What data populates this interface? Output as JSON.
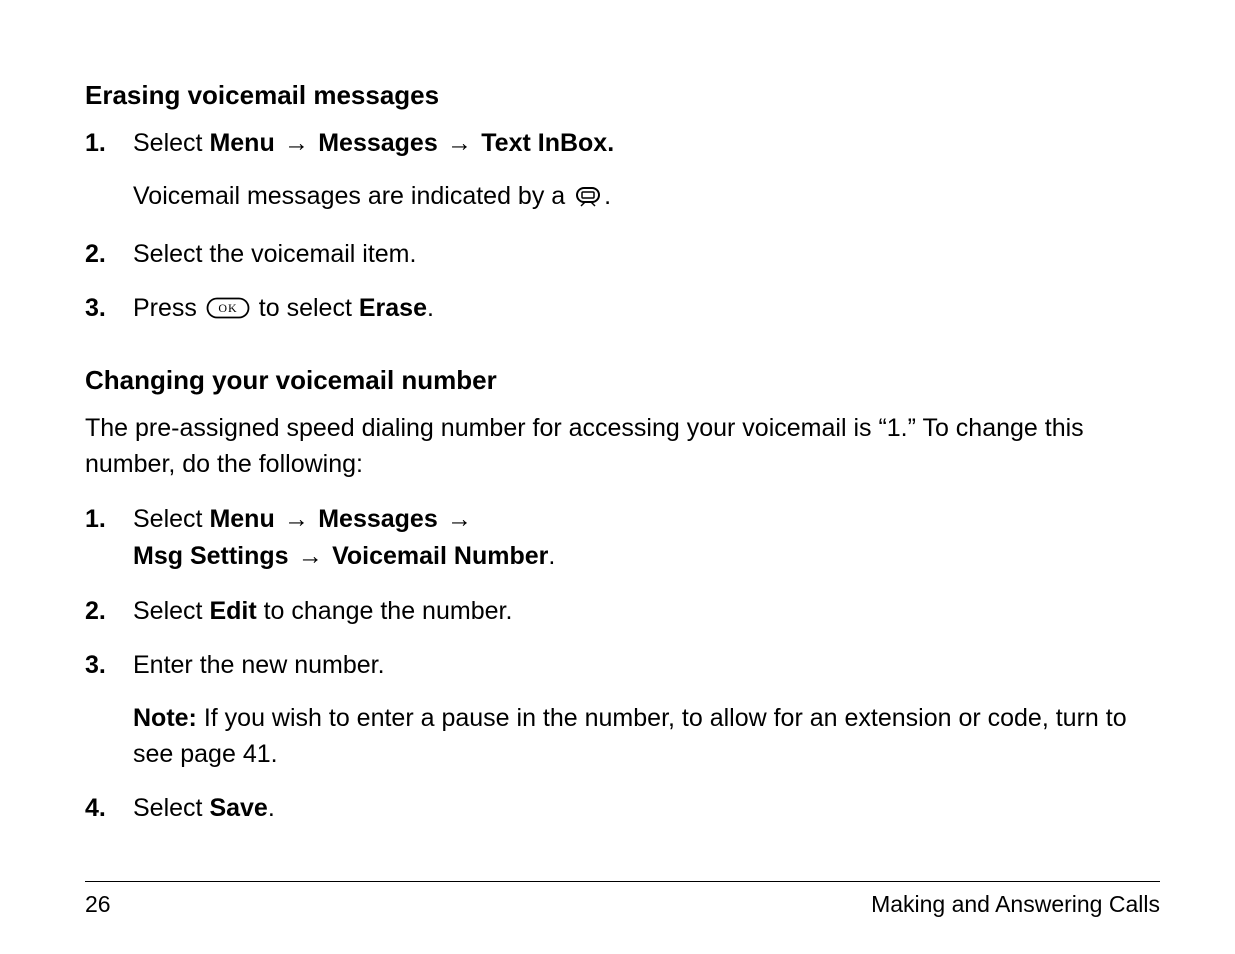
{
  "section1": {
    "heading": "Erasing voicemail messages",
    "items": [
      {
        "num": "1.",
        "pre": "Select ",
        "menu": "Menu",
        "arrow1": " → ",
        "messages": "Messages",
        "arrow2": " → ",
        "textinbox": "Text InBox.",
        "sub_pre": "Voicemail messages are indicated by a ",
        "sub_post": "."
      },
      {
        "num": "2.",
        "text": "Select the voicemail item."
      },
      {
        "num": "3.",
        "pre": "Press ",
        "mid": "  to select ",
        "erase": "Erase",
        "post": "."
      }
    ]
  },
  "section2": {
    "heading": "Changing your voicemail number",
    "intro": "The pre-assigned speed dialing number for accessing your voicemail is “1.” To change this number, do the following:",
    "items": [
      {
        "num": "1.",
        "pre": "Select ",
        "menu": "Menu",
        "arrow1": " → ",
        "messages": "Messages",
        "arrow2": " →",
        "msgsettings": "Msg Settings",
        "arrow3": " → ",
        "vmnumber": "Voicemail Number",
        "post": "."
      },
      {
        "num": "2.",
        "pre": "Select ",
        "edit": "Edit",
        "post": " to change the number."
      },
      {
        "num": "3.",
        "text": "Enter the new number.",
        "note_label": "Note:",
        "note_body": " If you wish to enter a pause in the number, to allow for an extension or code, turn to see page 41."
      },
      {
        "num": "4.",
        "pre": "Select ",
        "save": "Save",
        "post": "."
      }
    ]
  },
  "footer": {
    "page": "26",
    "title": "Making and Answering Calls"
  }
}
